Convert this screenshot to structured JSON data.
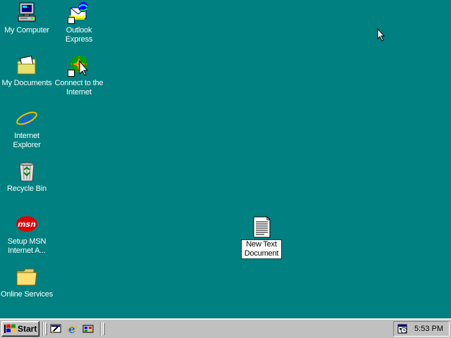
{
  "desktop": {
    "background_color": "#008080",
    "icons": [
      {
        "label": "My Computer",
        "icon": "my-computer-icon"
      },
      {
        "label": "Outlook Express",
        "icon": "outlook-express-icon"
      },
      {
        "label": "My Documents",
        "icon": "my-documents-icon"
      },
      {
        "label": "Connect to the Internet",
        "icon": "connect-internet-icon"
      },
      {
        "label": "Internet Explorer",
        "icon": "internet-explorer-icon"
      },
      {
        "label": "Recycle Bin",
        "icon": "recycle-bin-icon"
      },
      {
        "label": "Setup MSN Internet A...",
        "icon": "msn-icon"
      },
      {
        "label": "Online Services",
        "icon": "folder-icon"
      },
      {
        "label": "New Text Document",
        "icon": "text-document-icon",
        "selected": true
      }
    ]
  },
  "taskbar": {
    "start_label": "Start",
    "quick_launch": [
      {
        "name": "show-desktop",
        "icon": "show-desktop-icon"
      },
      {
        "name": "internet-explorer",
        "icon": "ie-small-icon"
      },
      {
        "name": "channels",
        "icon": "channels-icon"
      }
    ],
    "tray": {
      "icons": [
        "scheduler-icon"
      ],
      "clock": "5:53 PM"
    }
  }
}
